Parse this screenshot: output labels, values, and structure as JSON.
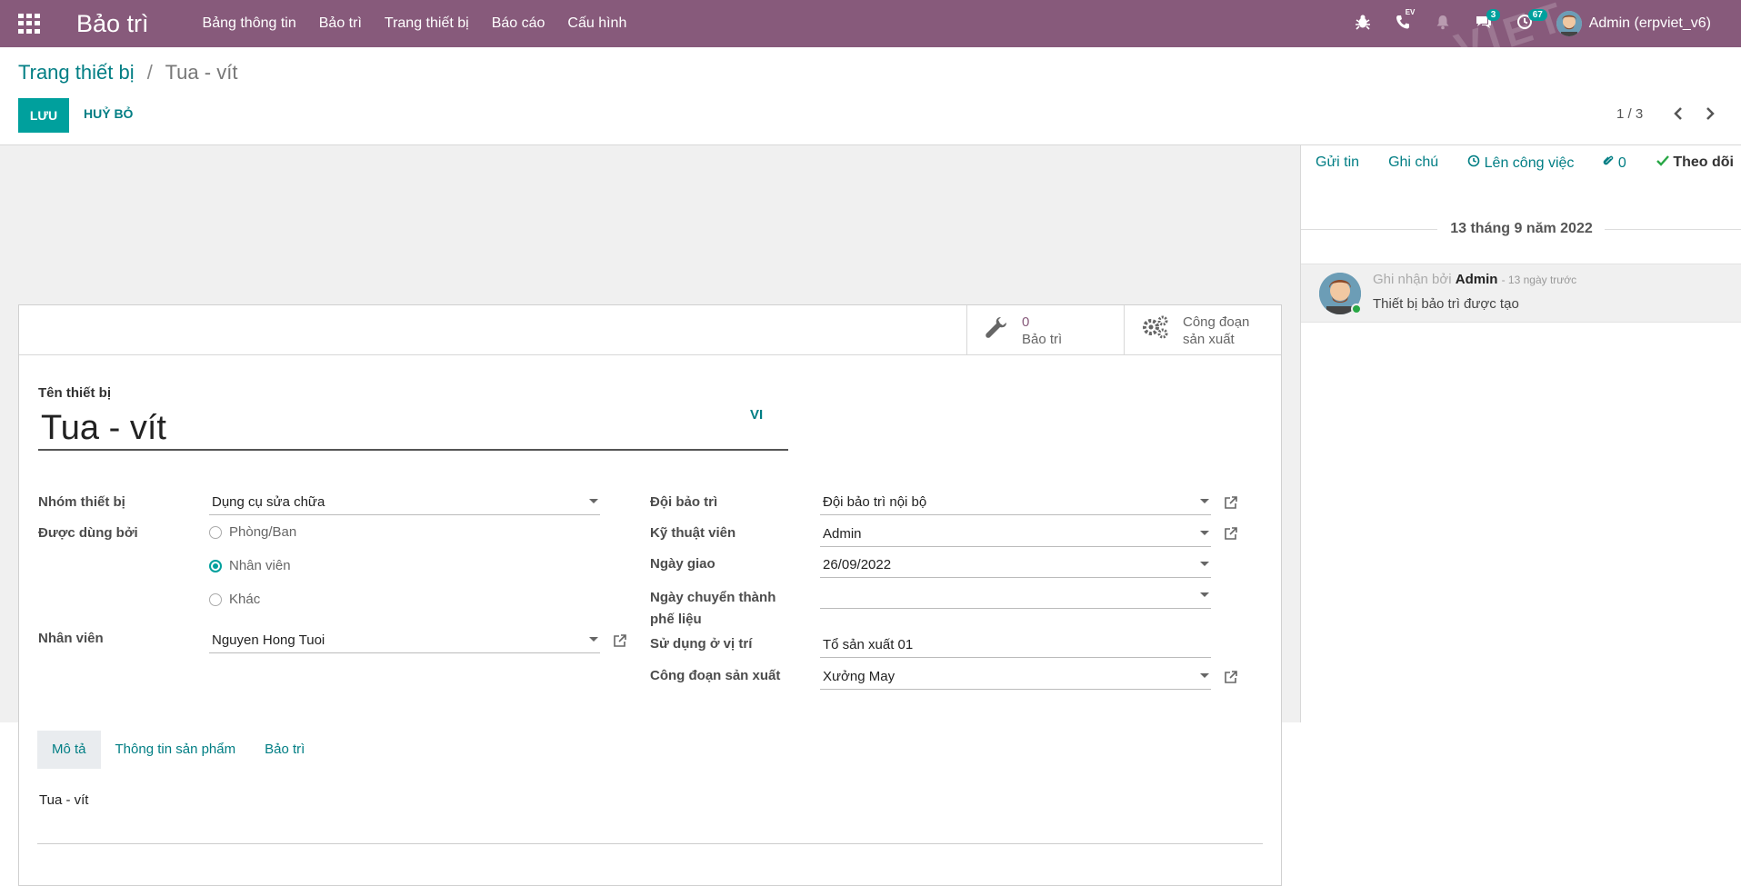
{
  "navbar": {
    "brand": "Bảo trì",
    "menu": [
      "Bảng thông tin",
      "Bảo trì",
      "Trang thiết bị",
      "Báo cáo",
      "Cấu hình"
    ],
    "phone_tag": "EV",
    "messages_count": "3",
    "activities_count": "67",
    "user": "Admin (erpviet_v6)",
    "watermark": "VIET"
  },
  "breadcrumb": {
    "parent": "Trang thiết bị",
    "separator": "/",
    "current": "Tua - vít"
  },
  "actions": {
    "save": "LƯU",
    "discard": "HUỶ BỎ"
  },
  "pager": {
    "value": "1 / 3"
  },
  "stat_buttons": {
    "maintenance": {
      "value": "0",
      "label": "Bảo trì"
    },
    "workcenter": {
      "label1": "Công đoạn",
      "label2": "sản xuất"
    }
  },
  "form": {
    "name_label": "Tên thiết bị",
    "name_value": "Tua - vít",
    "lang": "VI",
    "category_label": "Nhóm thiết bị",
    "category_value": "Dụng cụ sửa chữa",
    "used_by_label": "Được dùng bởi",
    "used_by_options": [
      "Phòng/Ban",
      "Nhân viên",
      "Khác"
    ],
    "used_by_selected": "Nhân viên",
    "employee_label": "Nhân viên",
    "employee_value": "Nguyen Hong Tuoi",
    "team_label": "Đội bảo trì",
    "team_value": "Đội bảo trì nội bộ",
    "technician_label": "Kỹ thuật viên",
    "technician_value": "Admin",
    "assign_date_label": "Ngày giao",
    "assign_date_value": "26/09/2022",
    "scrap_date_label1": "Ngày chuyển thành",
    "scrap_date_label2": "phế liệu",
    "scrap_date_value": "",
    "location_label": "Sử dụng ở vị trí",
    "location_value": "Tổ sản xuất 01",
    "workcenter_label": "Công đoạn sản xuất",
    "workcenter_value": "Xưởng May"
  },
  "tabs": [
    "Mô tả",
    "Thông tin sản phẩm",
    "Bảo trì"
  ],
  "description": "Tua - vít",
  "chatter": {
    "send_message": "Gửi tin",
    "log_note": "Ghi chú",
    "schedule_activity": "Lên công việc",
    "attachments": "0",
    "follow": "Theo dõi",
    "date_separator": "13 tháng 9 năm 2022",
    "message": {
      "prefix": "Ghi nhận bởi",
      "author": "Admin",
      "time": "- 13 ngày trước",
      "body": "Thiết bị bảo trì được tạo"
    }
  },
  "colors": {
    "navbar": "#875a7b",
    "primary": "#00a09d",
    "link": "#017e84"
  }
}
